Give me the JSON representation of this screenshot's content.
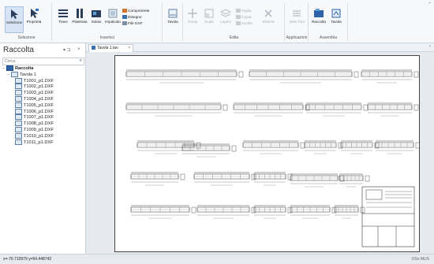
{
  "ribbon": {
    "groups": {
      "selezione": "Selezione",
      "inserisci": "Inserisci",
      "edita": "Edita",
      "applicazioni": "Applicazioni",
      "assembla": "Assembla"
    },
    "buttons": {
      "selezione": "Selezione",
      "proprieta": "Proprietà",
      "trave": "Trave",
      "pilastrata": "Pilastrata",
      "solaio": "Solaio",
      "impalcato": "Impalcato",
      "tavola": "Tavola",
      "trasla": "Trasla",
      "scala": "Scala",
      "layers": "Layers",
      "elimina": "Elimina",
      "view_tool": "View Tool",
      "raccolta": "Raccolta",
      "tavola2": "Tavola"
    },
    "small": {
      "componente": "Componente",
      "disegno": "Disegno",
      "file_dxf": "File DXF",
      "taglia": "Taglia",
      "copia": "Copia",
      "incolla": "Incolla"
    }
  },
  "panel": {
    "title": "Raccolta",
    "pin": "▾ ⊐",
    "close": "×",
    "search_placeholder": "Cerca",
    "tree": {
      "root": "Raccolta",
      "tavola": "Tavola 1",
      "files": [
        "T1001_p1.DXF",
        "T1002_p1.DXF",
        "T1003_p1.DXF",
        "T1004_p1.DXF",
        "T1005_p1.DXF",
        "T1006_p1.DXF",
        "T1007_p1.DXF",
        "T1008_p1.DXF",
        "T1009_p1.DXF",
        "T1010_p1.DXF",
        "T1011_p1.DXF"
      ]
    }
  },
  "tab": {
    "label": "Tavola 1.tav",
    "close": "×"
  },
  "status": {
    "coords": "x=-76.710979 y=54.448742",
    "mode": "OSn  MUS"
  }
}
